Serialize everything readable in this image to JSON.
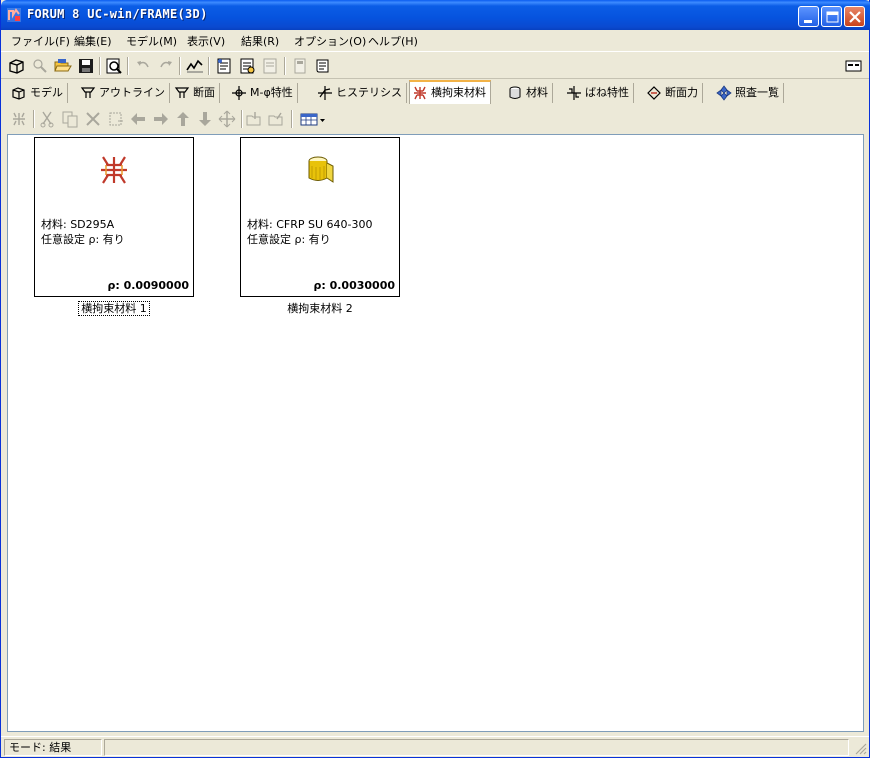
{
  "window": {
    "title": "FORUM 8  UC-win/FRAME(3D)"
  },
  "menu": {
    "items": [
      "ファイル(F)",
      "編集(E)",
      "モデル(M)",
      "表示(V)",
      "結果(R)",
      "オプション(O)",
      "ヘルプ(H)"
    ]
  },
  "tabs": [
    {
      "label": "モデル",
      "icon": "model-icon"
    },
    {
      "label": "アウトライン",
      "icon": "outline-icon"
    },
    {
      "label": "断面",
      "icon": "section-icon"
    },
    {
      "label": "M-φ特性",
      "icon": "m-phi-icon"
    },
    {
      "label": "ヒステリシス",
      "icon": "hysteresis-icon"
    },
    {
      "label": "横拘束材料",
      "icon": "lateral-restraint-icon",
      "active": true
    },
    {
      "label": "材料",
      "icon": "material-icon"
    },
    {
      "label": "ばね特性",
      "icon": "spring-icon"
    },
    {
      "label": "断面力",
      "icon": "section-force-icon"
    },
    {
      "label": "照査一覧",
      "icon": "check-list-icon"
    }
  ],
  "cards": [
    {
      "material": "材料: SD295A",
      "setting": "任意設定 ρ: 有り",
      "rho": "ρ: 0.0090000",
      "caption": "横拘束材料 1",
      "icon": "rebar-icon",
      "focused": true
    },
    {
      "material": "材料: CFRP SU 640-300",
      "setting": "任意設定 ρ: 有り",
      "rho": "ρ: 0.0030000",
      "caption": "横拘束材料 2",
      "icon": "cfrp-sheet-icon",
      "focused": false
    }
  ],
  "status": {
    "mode": "モード: 結果"
  },
  "colors": {
    "titlebar": "#0653de",
    "active_tab_accent": "#f2b247",
    "rebar": "#c0392b",
    "cfrp": "#e8c20a"
  }
}
